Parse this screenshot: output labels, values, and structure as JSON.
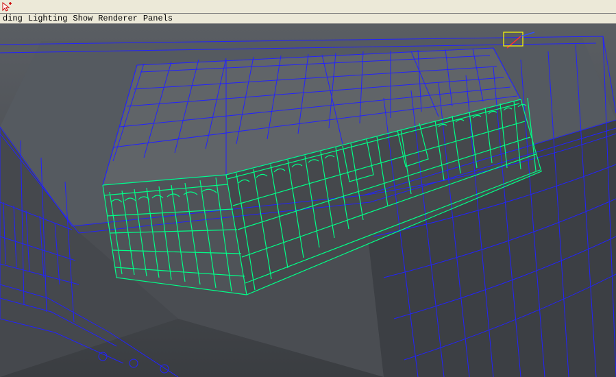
{
  "toolbar": {
    "cursor_tool": "select-cursor"
  },
  "menu": {
    "items": [
      "ding",
      "Lighting",
      "Show",
      "Renderer",
      "Panels"
    ]
  },
  "viewport": {
    "wireframe_color_unselected": "#1a1aff",
    "wireframe_color_selected": "#00ff88",
    "manipulator_color_x": "#ff2222",
    "manipulator_color_y": "#ffff00",
    "surface_shade": "#4a4d52"
  }
}
